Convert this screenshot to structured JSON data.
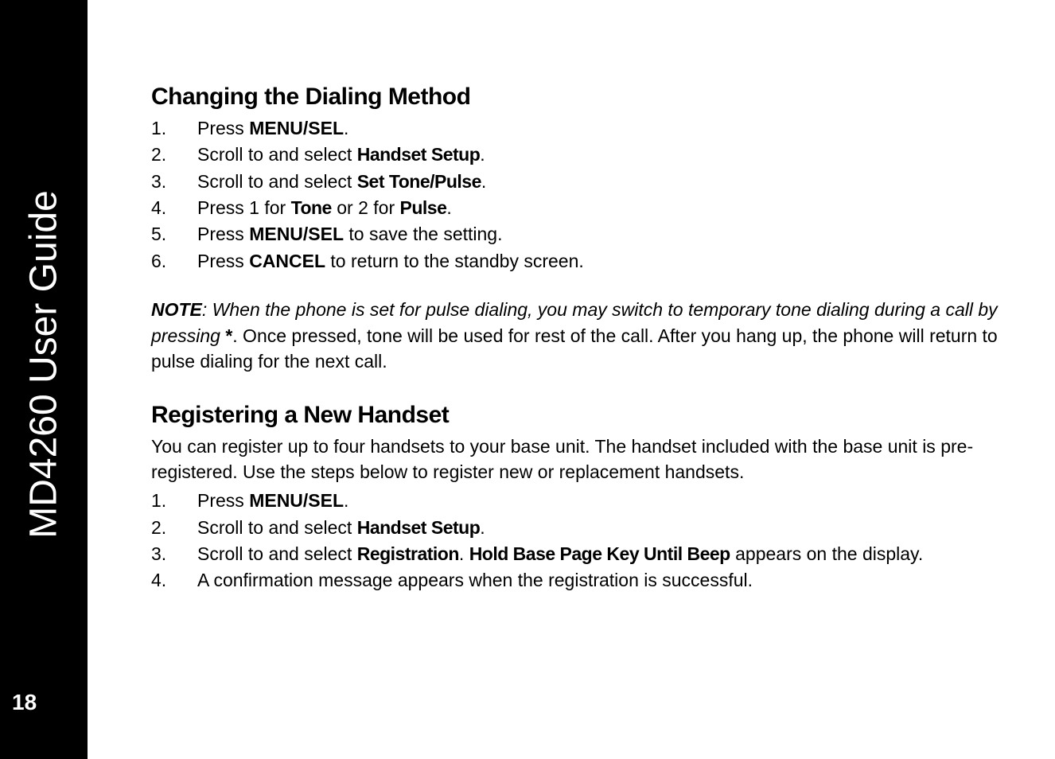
{
  "sidebar": {
    "title": "MD4260 User Guide",
    "page_number": "18"
  },
  "section1": {
    "heading": "Changing the Dialing Method",
    "steps": [
      {
        "pre": "Press ",
        "bold": "MENU/SEL",
        "post": "."
      },
      {
        "pre": "Scroll to and select ",
        "display": "Handset Setup",
        "post": "."
      },
      {
        "pre": "Scroll to and select ",
        "display": "Set Tone/Pulse",
        "post": "."
      },
      {
        "pre": "Press 1 for ",
        "display": "Tone",
        "mid": " or 2 for ",
        "display2": "Pulse",
        "post": "."
      },
      {
        "pre": "Press ",
        "bold": "MENU/SEL",
        "post": " to save the setting."
      },
      {
        "pre": "Press ",
        "bold": "CANCEL",
        "post": " to return to the standby screen."
      }
    ]
  },
  "note": {
    "label": "NOTE",
    "pre": ": When the phone is set for pulse dialing, you may switch to temporary tone dialing during a call by pressing ",
    "bold": "*",
    "post": ". Once pressed, tone will be used for rest of the call. After you hang up, the phone will return to pulse dialing for the next call."
  },
  "section2": {
    "heading": "Registering a New Handset",
    "intro": "You can register up to four handsets to your base unit. The handset included with the base unit is pre-registered. Use the steps below to register new or replacement handsets.",
    "steps": [
      {
        "pre": "Press ",
        "bold": "MENU/SEL",
        "post": "."
      },
      {
        "pre": "Scroll to and select ",
        "display": "Handset Setup",
        "post": "."
      },
      {
        "pre": "Scroll to and select ",
        "display": "Registration",
        "mid": ". ",
        "display2": "Hold Base Page Key Until Beep",
        "post": " appears on the display."
      },
      {
        "pre": "A confirmation message appears when the registration is successful."
      }
    ]
  }
}
